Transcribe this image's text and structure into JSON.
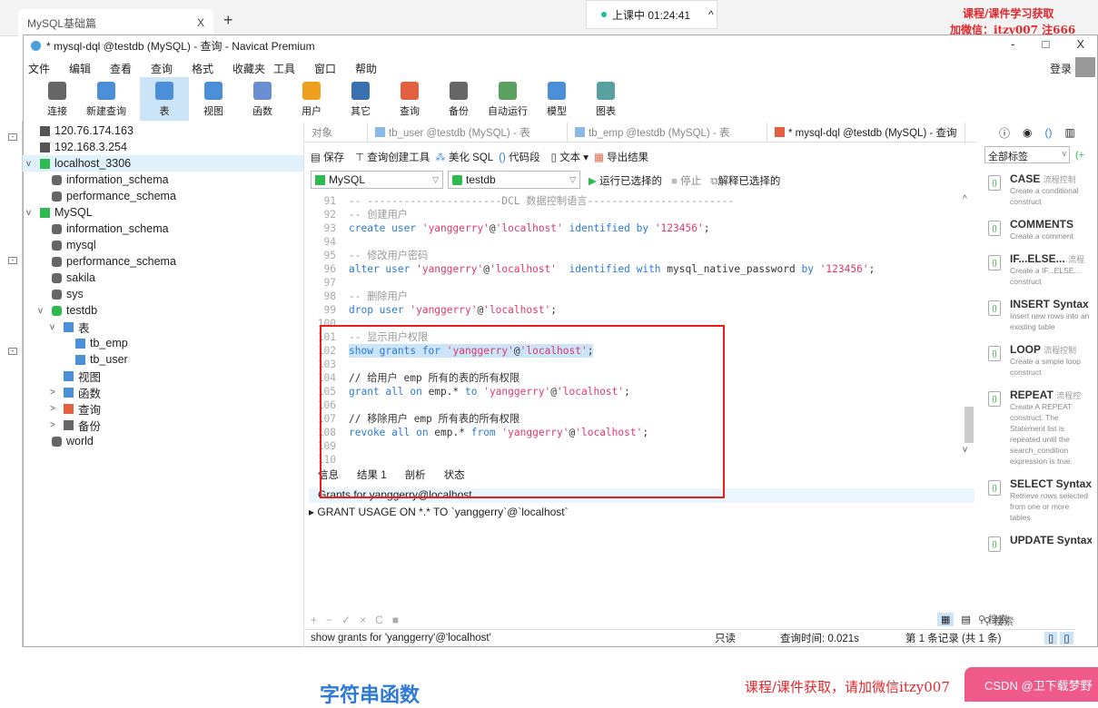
{
  "browser": {
    "tab_title": "MySQL基础篇",
    "close": "X",
    "new_tab": "+",
    "live_label": "上课中 01:24:41",
    "live_chevron": "^"
  },
  "watermark": {
    "line1": "课程/课件学习获取",
    "line2": "加微信：itzy007  注666",
    "bottom": "课程/课件获取，请加微信itzy007",
    "button": "CSDN @卫下载梦野"
  },
  "window": {
    "title": "* mysql-dql @testdb (MySQL) - 查询 - Navicat Premium",
    "min": "-",
    "max": "□",
    "close": "X",
    "menu": [
      "文件",
      "编辑",
      "查看",
      "查询",
      "格式",
      "收藏夹",
      "工具",
      "窗口",
      "帮助"
    ],
    "login": "登录",
    "toolbar": [
      {
        "label": "连接",
        "color": "#666"
      },
      {
        "label": "新建查询",
        "color": "#4a8fd8"
      },
      {
        "label": "表",
        "color": "#4a8fd8",
        "active": true
      },
      {
        "label": "视图",
        "color": "#4a8fd8"
      },
      {
        "label": "函数",
        "color": "#6a8fd0"
      },
      {
        "label": "用户",
        "color": "#f0a020"
      },
      {
        "label": "其它",
        "color": "#3a6fb0"
      },
      {
        "label": "查询",
        "color": "#e06040"
      },
      {
        "label": "备份",
        "color": "#666"
      },
      {
        "label": "自动运行",
        "color": "#5aa060"
      },
      {
        "label": "模型",
        "color": "#4a8fd8"
      },
      {
        "label": "图表",
        "color": "#5aa0a0"
      }
    ]
  },
  "tree": [
    {
      "label": "120.76.174.163",
      "depth": 0,
      "icon": "server-icon",
      "color": "#555"
    },
    {
      "label": "192.168.3.254",
      "depth": 0,
      "icon": "server-icon",
      "color": "#555"
    },
    {
      "label": "localhost_3306",
      "depth": 0,
      "icon": "server-icon",
      "color": "#2dba4e",
      "expanded": true,
      "selected": true
    },
    {
      "label": "information_schema",
      "depth": 1,
      "icon": "database-icon",
      "color": "#666"
    },
    {
      "label": "performance_schema",
      "depth": 1,
      "icon": "database-icon",
      "color": "#666"
    },
    {
      "label": "MySQL",
      "depth": 0,
      "icon": "server-icon",
      "color": "#2dba4e",
      "expanded": true
    },
    {
      "label": "information_schema",
      "depth": 1,
      "icon": "database-icon",
      "color": "#666"
    },
    {
      "label": "mysql",
      "depth": 1,
      "icon": "database-icon",
      "color": "#666"
    },
    {
      "label": "performance_schema",
      "depth": 1,
      "icon": "database-icon",
      "color": "#666"
    },
    {
      "label": "sakila",
      "depth": 1,
      "icon": "database-icon",
      "color": "#666"
    },
    {
      "label": "sys",
      "depth": 1,
      "icon": "database-icon",
      "color": "#666"
    },
    {
      "label": "testdb",
      "depth": 1,
      "icon": "database-icon",
      "color": "#2dba4e",
      "expanded": true
    },
    {
      "label": "表",
      "depth": 2,
      "icon": "table-icon",
      "color": "#4a8fd8",
      "expanded": true
    },
    {
      "label": "tb_emp",
      "depth": 3,
      "icon": "table-icon",
      "color": "#4a8fd8"
    },
    {
      "label": "tb_user",
      "depth": 3,
      "icon": "table-icon",
      "color": "#4a8fd8"
    },
    {
      "label": "视图",
      "depth": 2,
      "icon": "view-icon",
      "color": "#4a8fd8"
    },
    {
      "label": "函数",
      "depth": 2,
      "icon": "function-icon",
      "color": "#4a8fd8",
      "collapsed": true
    },
    {
      "label": "查询",
      "depth": 2,
      "icon": "query-icon",
      "color": "#e06040",
      "collapsed": true
    },
    {
      "label": "备份",
      "depth": 2,
      "icon": "backup-icon",
      "color": "#666",
      "collapsed": true
    },
    {
      "label": "world",
      "depth": 1,
      "icon": "database-icon",
      "color": "#666"
    }
  ],
  "tabs": [
    {
      "label": "对象"
    },
    {
      "label": "tb_user @testdb (MySQL) - 表"
    },
    {
      "label": "tb_emp @testdb (MySQL) - 表"
    },
    {
      "label": "* mysql-dql @testdb (MySQL) - 查询",
      "active": true
    }
  ],
  "editor_toolbar": {
    "save": "保存",
    "builder": "查询创建工具",
    "beautify": "美化 SQL",
    "snippet": "代码段",
    "text": "文本",
    "export": "导出结果"
  },
  "connection": "MySQL",
  "database": "testdb",
  "run": "运行已选择的",
  "stop": "停止",
  "explain": "解释已选择的",
  "code": [
    {
      "n": "91",
      "t": [
        [
          "cm",
          "-- ----------------------DCL 数据控制语言------------------------"
        ]
      ]
    },
    {
      "n": "92",
      "t": [
        [
          "cm",
          "-- 创建用户"
        ]
      ]
    },
    {
      "n": "93",
      "t": [
        [
          "kw",
          "create user "
        ],
        [
          "str",
          "'yanggerry'"
        ],
        [
          "id",
          "@"
        ],
        [
          "str",
          "'localhost'"
        ],
        [
          "kw",
          " identified by "
        ],
        [
          "str",
          "'123456'"
        ],
        [
          "id",
          ";"
        ]
      ]
    },
    {
      "n": "94",
      "t": []
    },
    {
      "n": "95",
      "t": [
        [
          "cm",
          "-- 修改用户密码"
        ]
      ]
    },
    {
      "n": "96",
      "t": [
        [
          "kw",
          "alter user "
        ],
        [
          "str",
          "'yanggerry'"
        ],
        [
          "id",
          "@"
        ],
        [
          "str",
          "'localhost'"
        ],
        [
          "kw",
          "  identified with "
        ],
        [
          "id",
          "mysql_native_password "
        ],
        [
          "kw",
          "by "
        ],
        [
          "str",
          "'123456'"
        ],
        [
          "id",
          ";"
        ]
      ]
    },
    {
      "n": "97",
      "t": []
    },
    {
      "n": "98",
      "t": [
        [
          "cm",
          "-- 删除用户"
        ]
      ]
    },
    {
      "n": "99",
      "t": [
        [
          "kw",
          "drop user "
        ],
        [
          "str",
          "'yanggerry'"
        ],
        [
          "id",
          "@"
        ],
        [
          "str",
          "'localhost'"
        ],
        [
          "id",
          ";"
        ]
      ]
    },
    {
      "n": "100",
      "t": []
    },
    {
      "n": "101",
      "t": [
        [
          "cm",
          "-- 显示用户权限"
        ]
      ]
    },
    {
      "n": "102",
      "hl": true,
      "t": [
        [
          "kw",
          "show grants for "
        ],
        [
          "str",
          "'yanggerry'"
        ],
        [
          "id",
          "@"
        ],
        [
          "str",
          "'localhost'"
        ],
        [
          "id",
          ";"
        ]
      ]
    },
    {
      "n": "103",
      "t": []
    },
    {
      "n": "104",
      "t": [
        [
          "id",
          "// 给用户 emp 所有的表的所有权限"
        ]
      ]
    },
    {
      "n": "105",
      "t": [
        [
          "kw",
          "grant all on "
        ],
        [
          "id",
          "emp.* "
        ],
        [
          "kw",
          "to "
        ],
        [
          "str",
          "'yanggerry'"
        ],
        [
          "id",
          "@"
        ],
        [
          "str",
          "'localhost'"
        ],
        [
          "id",
          ";"
        ]
      ]
    },
    {
      "n": "106",
      "t": []
    },
    {
      "n": "107",
      "t": [
        [
          "id",
          "// 移除用户 emp 所有表的所有权限"
        ]
      ]
    },
    {
      "n": "108",
      "t": [
        [
          "kw",
          "revoke all on "
        ],
        [
          "id",
          "emp.* "
        ],
        [
          "kw",
          "from "
        ],
        [
          "str",
          "'yanggerry'"
        ],
        [
          "id",
          "@"
        ],
        [
          "str",
          "'localhost'"
        ],
        [
          "id",
          ";"
        ]
      ]
    },
    {
      "n": "109",
      "t": []
    },
    {
      "n": "110",
      "t": []
    }
  ],
  "result_tabs": [
    "信息",
    "结果 1",
    "剖析",
    "状态"
  ],
  "result": {
    "header": "Grants for yanggerry@localhost",
    "rows": [
      "GRANT USAGE ON *.* TO `yanggerry`@`localhost`"
    ]
  },
  "bottom_tools": [
    "+",
    "−",
    "✓",
    "×",
    "C",
    "■"
  ],
  "result_search": "搜索",
  "status": {
    "sql": "show grants for 'yanggerry'@'localhost'",
    "mode": "只读",
    "time": "查询时间: 0.021s",
    "records": "第 1 条记录 (共 1 条)"
  },
  "snippets": {
    "filter": "全部标签",
    "search": "搜索",
    "items": [
      {
        "name": "CASE",
        "tag": "流程控制",
        "desc": "Create a conditional construct"
      },
      {
        "name": "COMMENTS",
        "tag": "",
        "desc": "Create a comment"
      },
      {
        "name": "IF...ELSE...",
        "tag": "流程",
        "desc": "Create a IF...ELSE... construct"
      },
      {
        "name": "INSERT Syntax",
        "tag": "",
        "desc": "Insert new rows into an existing table"
      },
      {
        "name": "LOOP",
        "tag": "流程控制",
        "desc": "Create a simple loop construct"
      },
      {
        "name": "REPEAT",
        "tag": "流程控",
        "desc": "Create A REPEAT construct. The Statement list is repeated until the search_condition expression is true."
      },
      {
        "name": "SELECT Syntax",
        "tag": "",
        "desc": "Retrieve rows selected from one or more tables"
      },
      {
        "name": "UPDATE Syntax",
        "tag": "",
        "desc": ""
      }
    ]
  },
  "page": {
    "heading": "字符串函数"
  }
}
